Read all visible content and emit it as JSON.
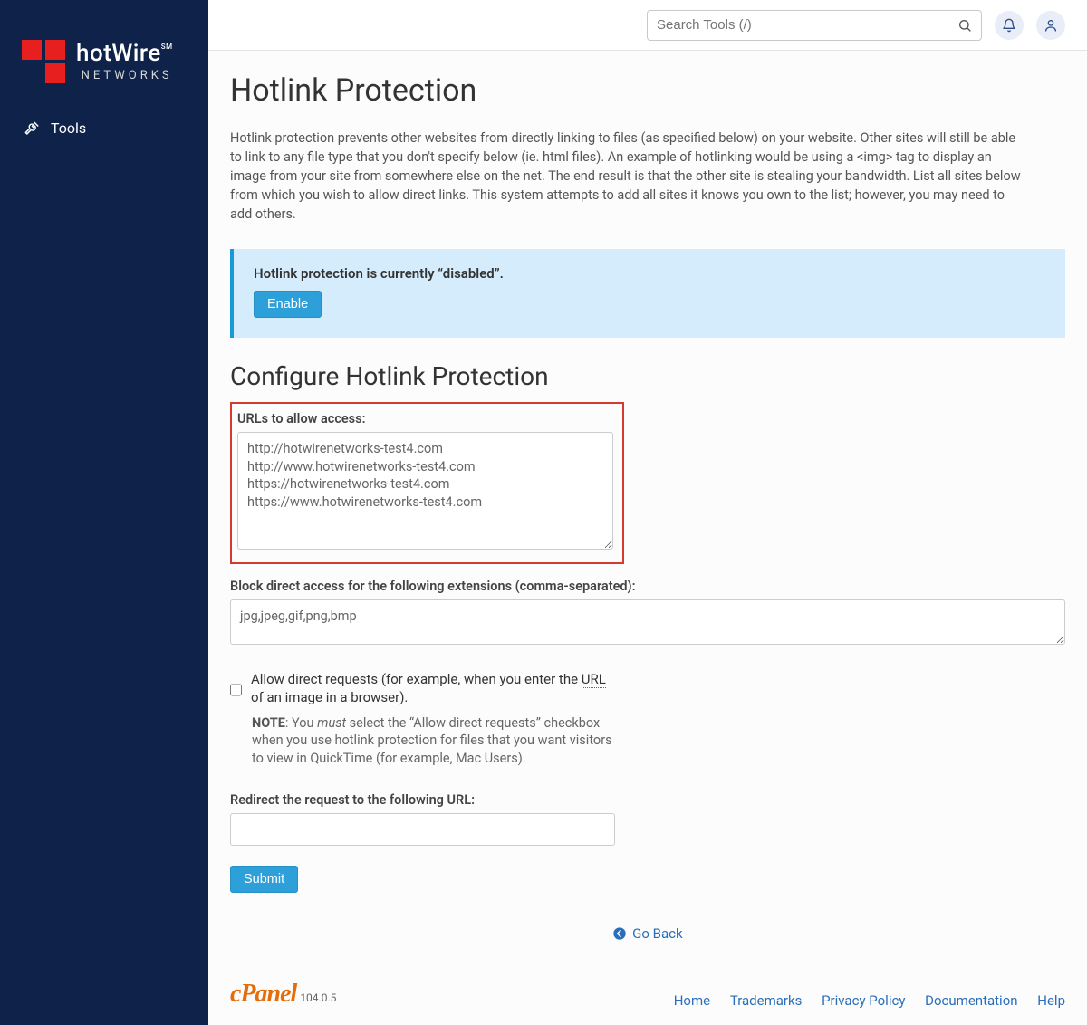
{
  "brand": {
    "name": "hotWire",
    "sm": "SM",
    "sub": "NETWORKS"
  },
  "sidebar": {
    "tools_label": "Tools"
  },
  "topbar": {
    "search_placeholder": "Search Tools (/)"
  },
  "page": {
    "title": "Hotlink Protection",
    "description": "Hotlink protection prevents other websites from directly linking to files (as specified below) on your website. Other sites will still be able to link to any file type that you don't specify below (ie. html files). An example of hotlinking would be using a <img> tag to display an image from your site from somewhere else on the net. The end result is that the other site is stealing your bandwidth. List all sites below from which you wish to allow direct links. This system attempts to add all sites it knows you own to the list; however, you may need to add others.",
    "status_line": "Hotlink protection is currently “disabled”.",
    "enable_label": "Enable",
    "configure_title": "Configure Hotlink Protection",
    "urls_label": "URLs to allow access:",
    "urls_value": "http://hotwirenetworks-test4.com\nhttp://www.hotwirenetworks-test4.com\nhttps://hotwirenetworks-test4.com\nhttps://www.hotwirenetworks-test4.com",
    "ext_label": "Block direct access for the following extensions (comma-separated):",
    "ext_value": "jpg,jpeg,gif,png,bmp",
    "allow_text_pre": "Allow direct requests (for example, when you enter the ",
    "allow_url_abbr": "URL",
    "allow_text_post": " of an image in a browser).",
    "note_label": "NOTE",
    "note_sep": ": You ",
    "note_must": "must",
    "note_rest": " select the “Allow direct requests” checkbox when you use hotlink protection for files that you want visitors to view in QuickTime (for example, Mac Users).",
    "redirect_label": "Redirect the request to the following URL:",
    "redirect_value": "",
    "submit_label": "Submit",
    "goback_label": "Go Back"
  },
  "footer": {
    "cpanel_word": "cPanel",
    "version": "104.0.5",
    "links": [
      "Home",
      "Trademarks",
      "Privacy Policy",
      "Documentation",
      "Help"
    ]
  }
}
